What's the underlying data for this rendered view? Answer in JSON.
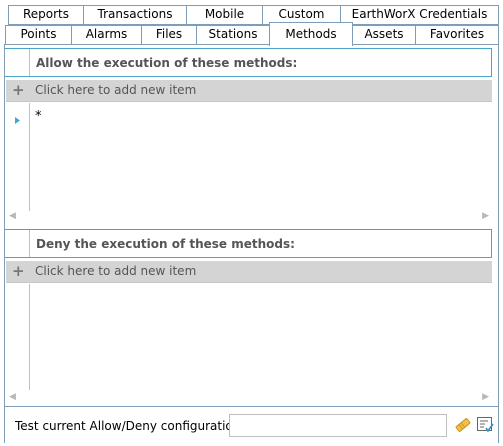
{
  "tabs_row1": [
    {
      "label": "Reports"
    },
    {
      "label": "Transactions"
    },
    {
      "label": "Mobile"
    },
    {
      "label": "Custom"
    },
    {
      "label": "EarthWorX Credentials"
    }
  ],
  "tabs_row2": [
    {
      "label": "Points"
    },
    {
      "label": "Alarms"
    },
    {
      "label": "Files"
    },
    {
      "label": "Stations"
    },
    {
      "label": "Methods",
      "selected": true
    },
    {
      "label": "Assets"
    },
    {
      "label": "Favorites"
    }
  ],
  "allow_section": {
    "title": "Allow the execution of these methods:",
    "add_label": "Click here to add new item",
    "items": [
      "*"
    ]
  },
  "deny_section": {
    "title": "Deny the execution of these methods:",
    "add_label": "Click here to add new item",
    "items": []
  },
  "test": {
    "label": "Test current Allow/Deny configuration:",
    "value": ""
  },
  "colors": {
    "accent": "#4aa3c9",
    "tab_border": "#7f9db9",
    "add_row_bg": "#d4d4d4"
  }
}
